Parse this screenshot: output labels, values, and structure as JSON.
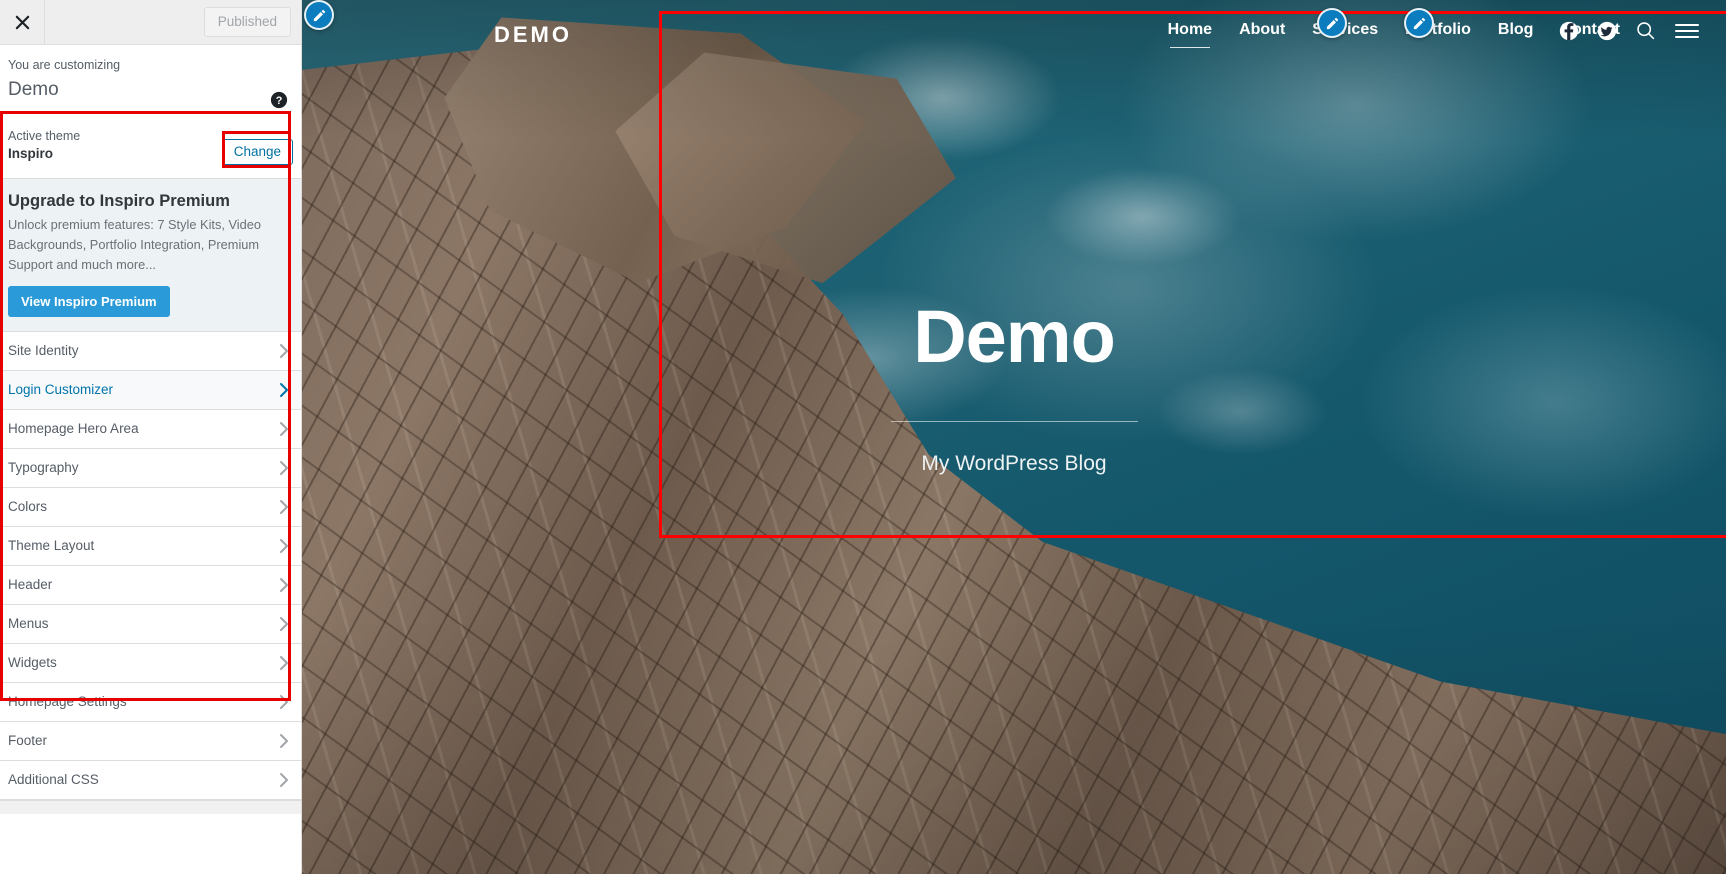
{
  "customizer": {
    "close_icon": "close-icon",
    "published_label": "Published",
    "you_are_customizing": "You are customizing",
    "site_name": "Demo",
    "help_icon": "help-icon",
    "active_theme_label": "Active theme",
    "active_theme_name": "Inspiro",
    "change_button": "Change",
    "upgrade": {
      "title": "Upgrade to Inspiro Premium",
      "description": "Unlock premium features: 7 Style Kits, Video Backgrounds, Portfolio Integration, Premium Support and much more...",
      "cta_label": "View Inspiro Premium"
    },
    "panels": [
      {
        "label": "Site Identity",
        "active": false
      },
      {
        "label": "Login Customizer",
        "active": true
      },
      {
        "label": "Homepage Hero Area",
        "active": false
      },
      {
        "label": "Typography",
        "active": false
      },
      {
        "label": "Colors",
        "active": false
      },
      {
        "label": "Theme Layout",
        "active": false
      },
      {
        "label": "Header",
        "active": false
      },
      {
        "label": "Menus",
        "active": false
      },
      {
        "label": "Widgets",
        "active": false
      },
      {
        "label": "Homepage Settings",
        "active": false
      },
      {
        "label": "Footer",
        "active": false
      },
      {
        "label": "Additional CSS",
        "active": false
      }
    ]
  },
  "preview": {
    "logo": "DEMO",
    "nav": [
      {
        "label": "Home",
        "current": true
      },
      {
        "label": "About",
        "current": false
      },
      {
        "label": "Services",
        "current": false
      },
      {
        "label": "Portfolio",
        "current": false
      },
      {
        "label": "Blog",
        "current": false
      },
      {
        "label": "Contact",
        "current": false
      }
    ],
    "icons": [
      "facebook-icon",
      "twitter-icon",
      "search-icon",
      "hamburger-menu-icon"
    ],
    "hero_title": "Demo",
    "hero_tagline": "My WordPress Blog",
    "edit_pin_icon": "pencil-edit-icon"
  },
  "colors": {
    "accent_blue": "#0b7cbd",
    "cta_blue": "#2a9bd8",
    "link_blue": "#0073aa",
    "highlight_red": "#ff0000",
    "sidebar_bg": "#ffffff",
    "upgrade_bg": "#edf2f5"
  }
}
